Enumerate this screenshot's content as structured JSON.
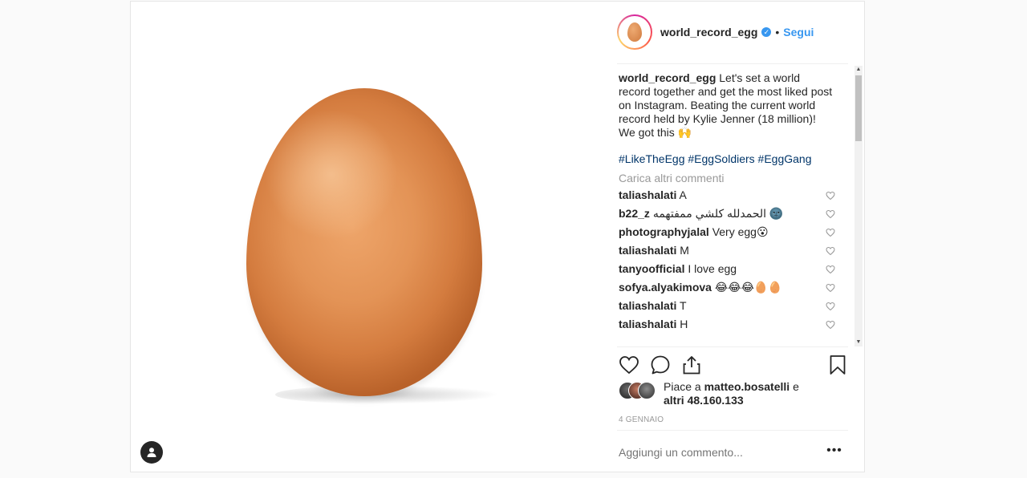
{
  "header": {
    "username": "world_record_egg",
    "verified_mark": "✓",
    "separator": "•",
    "follow_label": "Segui"
  },
  "caption": {
    "username": "world_record_egg",
    "text": "Let's set a world record together and get the most liked post on Instagram. Beating the current world record held by Kylie Jenner (18 million)! We got this 🙌",
    "hashtags": "#LikeTheEgg #EggSoldiers #EggGang"
  },
  "load_more_label": "Carica altri commenti",
  "comments": [
    {
      "user": "taliashalati",
      "text": "A"
    },
    {
      "user": "b22_z",
      "text": "الحمدلله كلشي ممفتهمه 🌚"
    },
    {
      "user": "photographyjalal",
      "text": "Very egg😮"
    },
    {
      "user": "taliashalati",
      "text": "M"
    },
    {
      "user": "tanyoofficial",
      "text": "I love egg"
    },
    {
      "user": "sofya.alyakimova",
      "text": "😂😂😂🥚🥚"
    },
    {
      "user": "taliashalati",
      "text": "T"
    },
    {
      "user": "taliashalati",
      "text": "H"
    }
  ],
  "likes": {
    "prefix": "Piace a ",
    "user": "matteo.bosatelli",
    "suffix": " e",
    "others_prefix": "altri ",
    "count": "48.160.133"
  },
  "date": "4 GENNAIO",
  "add_comment_placeholder": "Aggiungi un commento...",
  "more_label": "•••",
  "colors": {
    "link": "#3897f0",
    "hashtag": "#003569",
    "muted": "#999999",
    "egg": "#e39356"
  },
  "icons": {
    "like": "heart-icon",
    "comment": "comment-icon",
    "share": "share-icon",
    "save": "bookmark-icon",
    "user_tag": "user-icon"
  }
}
